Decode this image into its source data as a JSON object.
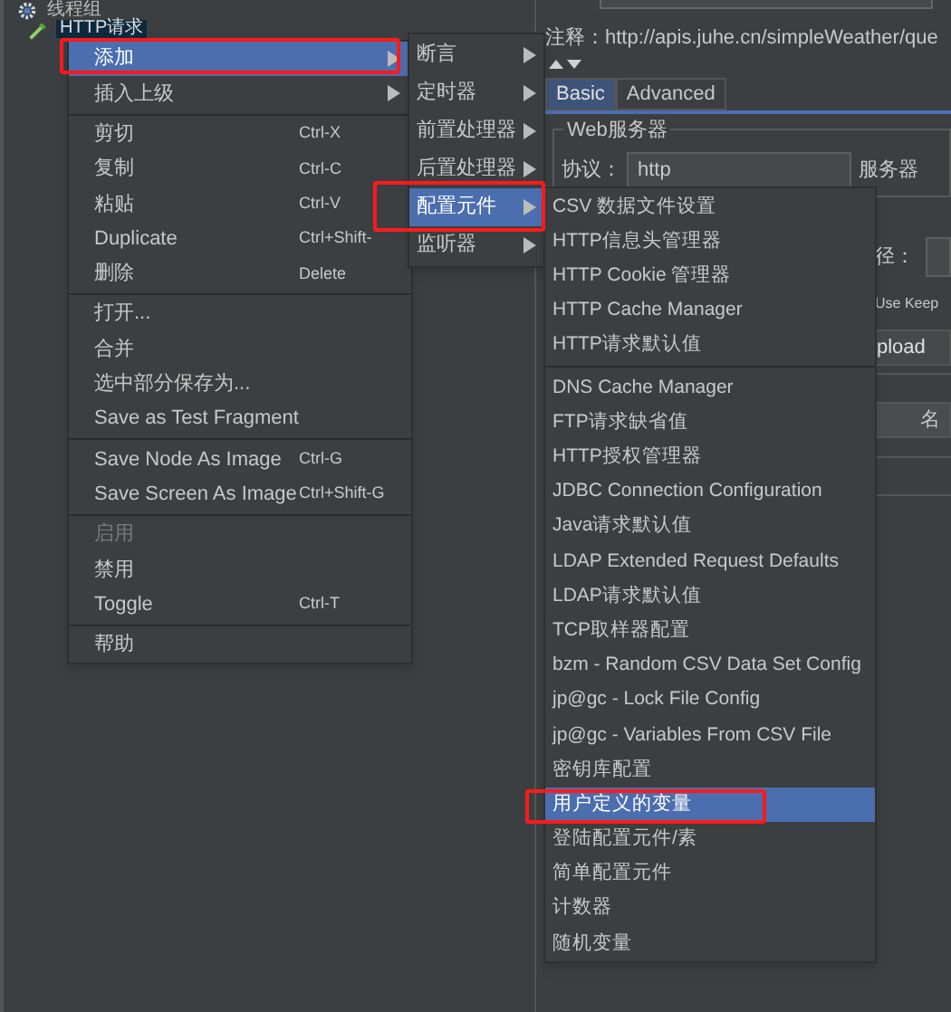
{
  "tree": [
    {
      "label": "线程组",
      "selected": false,
      "children": [
        {
          "label": "HTTP请求",
          "selected": true
        }
      ]
    }
  ],
  "comment": {
    "label": "注释：",
    "value": "http://apis.juhe.cn/simpleWeather/que"
  },
  "tabs": [
    {
      "label": "Basic",
      "selected": true
    },
    {
      "label": "Advanced",
      "selected": false
    }
  ],
  "web_server": {
    "title": "Web服务器",
    "protocol_label": "协议：",
    "protocol_value": "http",
    "server_label": "服务器"
  },
  "path_label": "径：",
  "keepalive_label": "Use Keep",
  "lower_tab": "pload",
  "table_column_1": "名",
  "context_menu": [
    {
      "kind": "item",
      "label": "添加",
      "submenu": true,
      "selected": true,
      "disabled": false
    },
    {
      "kind": "item",
      "label": "插入上级",
      "submenu": true,
      "selected": false,
      "disabled": false
    },
    {
      "kind": "separator"
    },
    {
      "kind": "item",
      "label": "剪切",
      "shortcut": "Ctrl-X",
      "submenu": false,
      "selected": false,
      "disabled": false
    },
    {
      "kind": "item",
      "label": "复制",
      "shortcut": "Ctrl-C",
      "submenu": false,
      "selected": false,
      "disabled": false
    },
    {
      "kind": "item",
      "label": "粘贴",
      "shortcut": "Ctrl-V",
      "submenu": false,
      "selected": false,
      "disabled": false
    },
    {
      "kind": "item",
      "label": "Duplicate",
      "shortcut": "Ctrl+Shift-",
      "submenu": false,
      "selected": false,
      "disabled": false
    },
    {
      "kind": "item",
      "label": "删除",
      "shortcut": "Delete",
      "submenu": false,
      "selected": false,
      "disabled": false
    },
    {
      "kind": "separator"
    },
    {
      "kind": "item",
      "label": "打开...",
      "submenu": false,
      "selected": false,
      "disabled": false
    },
    {
      "kind": "item",
      "label": "合并",
      "submenu": false,
      "selected": false,
      "disabled": false
    },
    {
      "kind": "item",
      "label": "选中部分保存为...",
      "submenu": false,
      "selected": false,
      "disabled": false
    },
    {
      "kind": "item",
      "label": "Save as Test Fragment",
      "submenu": false,
      "selected": false,
      "disabled": false
    },
    {
      "kind": "separator"
    },
    {
      "kind": "item",
      "label": "Save Node As Image",
      "shortcut": "Ctrl-G",
      "submenu": false,
      "selected": false,
      "disabled": false
    },
    {
      "kind": "item",
      "label": "Save Screen As Image",
      "shortcut": "Ctrl+Shift-G",
      "submenu": false,
      "selected": false,
      "disabled": false
    },
    {
      "kind": "separator"
    },
    {
      "kind": "item",
      "label": "启用",
      "submenu": false,
      "selected": false,
      "disabled": true
    },
    {
      "kind": "item",
      "label": "禁用",
      "submenu": false,
      "selected": false,
      "disabled": false
    },
    {
      "kind": "item",
      "label": "Toggle",
      "shortcut": "Ctrl-T",
      "submenu": false,
      "selected": false,
      "disabled": false
    },
    {
      "kind": "separator"
    },
    {
      "kind": "item",
      "label": "帮助",
      "submenu": false,
      "selected": false,
      "disabled": false
    }
  ],
  "add_submenu": [
    {
      "kind": "item",
      "label": "断言",
      "submenu": true,
      "selected": false
    },
    {
      "kind": "item",
      "label": "定时器",
      "submenu": true,
      "selected": false
    },
    {
      "kind": "item",
      "label": "前置处理器",
      "submenu": true,
      "selected": false
    },
    {
      "kind": "item",
      "label": "后置处理器",
      "submenu": true,
      "selected": false
    },
    {
      "kind": "item",
      "label": "配置元件",
      "submenu": true,
      "selected": true
    },
    {
      "kind": "item",
      "label": "监听器",
      "submenu": true,
      "selected": false
    }
  ],
  "config_submenu": [
    {
      "kind": "item",
      "label": "CSV 数据文件设置",
      "selected": false
    },
    {
      "kind": "item",
      "label": "HTTP信息头管理器",
      "selected": false
    },
    {
      "kind": "item",
      "label": "HTTP Cookie 管理器",
      "selected": false
    },
    {
      "kind": "item",
      "label": "HTTP Cache Manager",
      "selected": false
    },
    {
      "kind": "item",
      "label": "HTTP请求默认值",
      "selected": false
    },
    {
      "kind": "separator"
    },
    {
      "kind": "item",
      "label": "DNS Cache Manager",
      "selected": false
    },
    {
      "kind": "item",
      "label": "FTP请求缺省值",
      "selected": false
    },
    {
      "kind": "item",
      "label": "HTTP授权管理器",
      "selected": false
    },
    {
      "kind": "item",
      "label": "JDBC Connection Configuration",
      "selected": false
    },
    {
      "kind": "item",
      "label": "Java请求默认值",
      "selected": false
    },
    {
      "kind": "item",
      "label": "LDAP Extended Request Defaults",
      "selected": false
    },
    {
      "kind": "item",
      "label": "LDAP请求默认值",
      "selected": false
    },
    {
      "kind": "item",
      "label": "TCP取样器配置",
      "selected": false
    },
    {
      "kind": "item",
      "label": "bzm - Random CSV Data Set Config",
      "selected": false
    },
    {
      "kind": "item",
      "label": "jp@gc - Lock File Config",
      "selected": false
    },
    {
      "kind": "item",
      "label": "jp@gc - Variables From CSV File",
      "selected": false
    },
    {
      "kind": "item",
      "label": "密钥库配置",
      "selected": false
    },
    {
      "kind": "item",
      "label": "用户定义的变量",
      "selected": true
    },
    {
      "kind": "item",
      "label": "登陆配置元件/素",
      "selected": false
    },
    {
      "kind": "item",
      "label": "简单配置元件",
      "selected": false
    },
    {
      "kind": "item",
      "label": "计数器",
      "selected": false
    },
    {
      "kind": "item",
      "label": "随机变量",
      "selected": false
    }
  ]
}
